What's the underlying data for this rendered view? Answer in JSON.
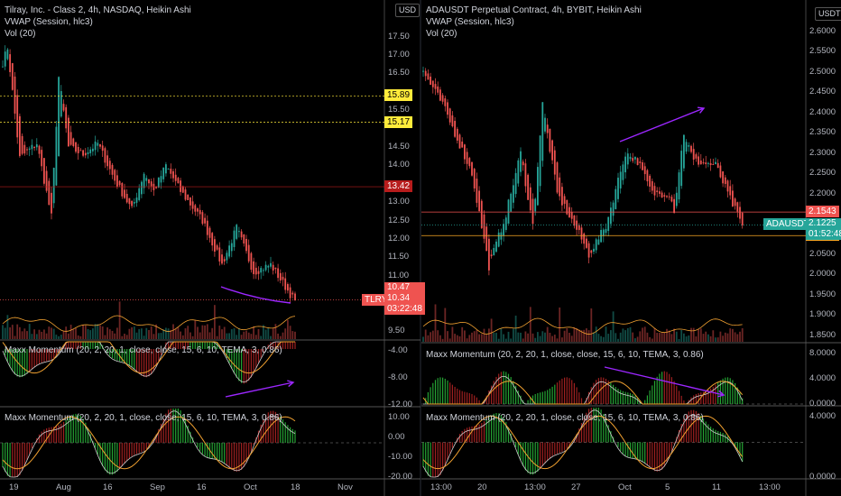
{
  "left": {
    "legend": {
      "title": "Tilray, Inc. - Class 2, 4h, NASDAQ, Heikin Ashi",
      "vwap": "VWAP (Session, hlc3)",
      "vol": "Vol (20)"
    },
    "currency": "USD",
    "price_ticks": [
      "17.50",
      "17.00",
      "16.50",
      "15.50",
      "14.50",
      "14.00",
      "13.00",
      "12.50",
      "12.00",
      "11.50",
      "11.00",
      "9.50"
    ],
    "price_range": [
      9.4,
      18.3
    ],
    "levels": [
      {
        "value": "15.89",
        "price": 15.89,
        "color": "#ffeb3b",
        "text": "#000"
      },
      {
        "value": "15.17",
        "price": 15.17,
        "color": "#ffeb3b",
        "text": "#000"
      },
      {
        "value": "13.42",
        "price": 13.42,
        "color": "#b71c1c",
        "text": "#fff"
      }
    ],
    "last": {
      "symbol": "TLRY",
      "high": "10.47",
      "price": "10.34",
      "countdown": "03:22:48",
      "value": 10.34,
      "color": "#ef5350"
    },
    "osc1": {
      "label": "Maxx Momentum (20, 2, 20, 1, close, close, 15, 6, 10, TEMA, 3, 0.86)",
      "ticks": [
        "-4.00",
        "-8.00",
        "-12.00"
      ]
    },
    "osc2": {
      "label": "Maxx Momentum (20, 2, 20, 1, close, close, 15, 6, 10, TEMA, 3, 0.86)",
      "ticks": [
        "10.00",
        "0.00",
        "-10.00",
        "-20.00"
      ]
    },
    "time_ticks": [
      "19",
      "Aug",
      "16",
      "Sep",
      "16",
      "Oct",
      "18",
      "Nov"
    ],
    "anchors": [
      [
        0,
        16.8
      ],
      [
        2,
        17.2
      ],
      [
        7,
        14.2
      ],
      [
        14,
        14.6
      ],
      [
        20,
        12.6
      ],
      [
        23,
        16.4
      ],
      [
        27,
        14.5
      ],
      [
        33,
        14.3
      ],
      [
        39,
        14.6
      ],
      [
        46,
        13.6
      ],
      [
        53,
        12.8
      ],
      [
        58,
        13.8
      ],
      [
        62,
        13.3
      ],
      [
        67,
        14.0
      ],
      [
        73,
        13.3
      ],
      [
        82,
        12.5
      ],
      [
        90,
        11.3
      ],
      [
        96,
        12.3
      ],
      [
        103,
        11.1
      ],
      [
        110,
        11.3
      ],
      [
        120,
        10.3
      ]
    ]
  },
  "right": {
    "legend": {
      "title": "ADAUSDT Perpetual Contract, 4h, BYBIT, Heikin Ashi",
      "vwap": "VWAP (Session, hlc3)",
      "vol": "Vol (20)"
    },
    "currency": "USDT",
    "price_ticks": [
      "2.6000",
      "2.5500",
      "2.5000",
      "2.4500",
      "2.4000",
      "2.3500",
      "2.3000",
      "2.2500",
      "2.2000",
      "2.0500",
      "2.0000",
      "1.9500",
      "1.9000",
      "1.8500"
    ],
    "price_range": [
      1.845,
      2.66
    ],
    "levels": [
      {
        "value": "2.1543",
        "price": 2.1543,
        "color": "#ef5350",
        "text": "#fff"
      },
      {
        "value": "2.0961",
        "price": 2.0961,
        "color": "#f9a825",
        "text": "#000"
      }
    ],
    "last": {
      "symbol": "ADAUSDT",
      "price": "2.1225",
      "countdown": "01:52:48",
      "value": 2.1225,
      "color": "#26a69a"
    },
    "osc1": {
      "label": "Maxx Momentum (20, 2, 20, 1, close, close, 15, 6, 10, TEMA, 3, 0.86)",
      "ticks": [
        "8.0000",
        "4.0000",
        "0.0000"
      ]
    },
    "osc2": {
      "label": "Maxx Momentum (20, 2, 20, 1, close, close, 15, 6, 10, TEMA, 3, 0.86)",
      "ticks": [
        "4.0000",
        "0.0000"
      ]
    },
    "time_ticks": [
      "13:00",
      "20",
      "13:00",
      "27",
      "Oct",
      "5",
      "11",
      "13:00"
    ],
    "anchors": [
      [
        0,
        2.5
      ],
      [
        8,
        2.42
      ],
      [
        20,
        2.25
      ],
      [
        27,
        2.02
      ],
      [
        34,
        2.15
      ],
      [
        40,
        2.3
      ],
      [
        45,
        2.12
      ],
      [
        49,
        2.42
      ],
      [
        55,
        2.2
      ],
      [
        64,
        2.1
      ],
      [
        68,
        2.05
      ],
      [
        75,
        2.12
      ],
      [
        83,
        2.3
      ],
      [
        88,
        2.28
      ],
      [
        94,
        2.2
      ],
      [
        101,
        2.2
      ],
      [
        103,
        2.16
      ],
      [
        107,
        2.35
      ],
      [
        111,
        2.28
      ],
      [
        120,
        2.27
      ],
      [
        125,
        2.2
      ],
      [
        131,
        2.12
      ]
    ]
  },
  "colors": {
    "up": "#26a69a",
    "down": "#ef5350",
    "vwap": "#f0a030",
    "arrow": "#9c27ff",
    "grid": "#2a2e39"
  }
}
